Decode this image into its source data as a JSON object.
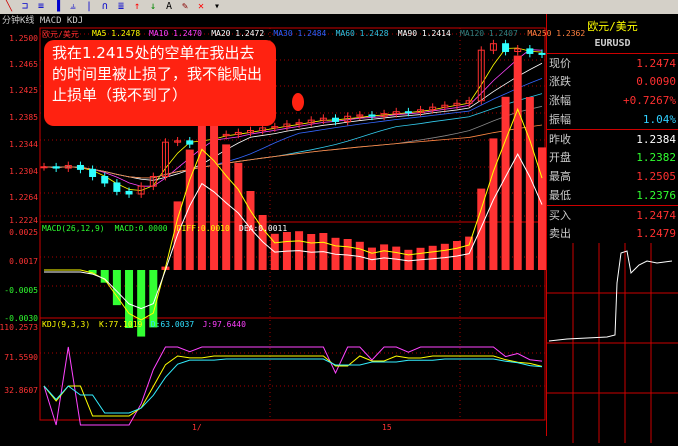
{
  "toolbar": {
    "icons": [
      "line-tool-icon",
      "channel-tool-icon",
      "parallel-lines-icon",
      "bars-icon",
      "fibonacci-icon",
      "vertical-line-icon",
      "gann-icon",
      "fan-icon",
      "up-arrow-icon",
      "down-arrow-icon",
      "text-icon",
      "eraser-icon",
      "delete-icon",
      "dropdown-icon"
    ],
    "glyphs": [
      "╲",
      "⊐",
      "≡",
      "▐",
      "⫨",
      "|",
      "∩",
      "≣",
      "↑",
      "↓",
      "A",
      "✎",
      "✕",
      "▾"
    ]
  },
  "tabs": {
    "label": "分钟K线 MACD KDJ"
  },
  "main": {
    "header": [
      {
        "t": "欧元/美元",
        "c": "#ff3030"
      },
      {
        "t": "MA5 1.2478",
        "c": "#ffff00"
      },
      {
        "t": "MA10 1.2470",
        "c": "#ff40ff"
      },
      {
        "t": "MA20 1.2472",
        "c": "#ffffff"
      },
      {
        "t": "MA30 1.2484",
        "c": "#3060ff"
      },
      {
        "t": "MA60 1.2428",
        "c": "#30c0e0"
      },
      {
        "t": "MA90 1.2414",
        "c": "#ffffff"
      },
      {
        "t": "MA120 1.2407",
        "c": "#308080"
      },
      {
        "t": "MA250 1.2362",
        "c": "#ff8040"
      }
    ],
    "y_labels": [
      "1.2500",
      "1.2465",
      "1.2425",
      "1.2385",
      "1.2344",
      "1.2304",
      "1.2264",
      "1.2224"
    ]
  },
  "macd": {
    "header": [
      {
        "t": "MACD(26,12,9)",
        "c": "#30ff30"
      },
      {
        "t": "MACD:0.0000",
        "c": "#30ff30"
      },
      {
        "t": "DIFF:0.0010",
        "c": "#ffff00"
      },
      {
        "t": "DEA:0.0011",
        "c": "#ffffff"
      }
    ],
    "y_labels": [
      "0.0025",
      "0.0017",
      "-0.0005",
      "-0.0030"
    ]
  },
  "kdj": {
    "header": [
      {
        "t": "KDJ(9,3,3)",
        "c": "#ffff00"
      },
      {
        "t": "K:77.1019",
        "c": "#ffff00"
      },
      {
        "t": "D:63.0037",
        "c": "#30e0ff"
      },
      {
        "t": "J:97.6440",
        "c": "#ff40ff"
      }
    ],
    "y_labels": [
      "110.2573",
      "71.5590",
      "32.8607"
    ]
  },
  "time_labels": [
    "1/",
    "15"
  ],
  "annotation": "我在1.2415处的空单在我出去的时间里被止损了，我不能贴出止损单（我不到了）",
  "quote": {
    "title": "欧元/美元",
    "symbol": "EURUSD",
    "rows": [
      {
        "l": "现价",
        "v": "1.2474",
        "c": "#ff3030"
      },
      {
        "l": "涨跌",
        "v": "0.0090",
        "c": "#ff3030"
      },
      {
        "l": "涨幅",
        "v": "+0.7267%",
        "c": "#ff3030"
      },
      {
        "l": "振幅",
        "v": "1.04%",
        "c": "#30d0ff"
      },
      {
        "l": "昨收",
        "v": "1.2384",
        "c": "#ffffff"
      },
      {
        "l": "开盘",
        "v": "1.2382",
        "c": "#30ff30"
      },
      {
        "l": "最高",
        "v": "1.2505",
        "c": "#ff3030"
      },
      {
        "l": "最低",
        "v": "1.2376",
        "c": "#30ff30"
      },
      {
        "l": "买入",
        "v": "1.2474",
        "c": "#ff3030"
      },
      {
        "l": "卖出",
        "v": "1.2479",
        "c": "#ff3030"
      }
    ]
  },
  "colors": {
    "up": "#ff3030",
    "down": "#30ffff",
    "frame": "#cc0000"
  },
  "chart_data": {
    "type": "candlestick",
    "ylim": [
      1.2224,
      1.2505
    ],
    "closes": [
      1.23,
      1.2298,
      1.2302,
      1.2296,
      1.2285,
      1.2275,
      1.2262,
      1.2258,
      1.227,
      1.2285,
      1.2338,
      1.234,
      1.2335,
      1.2345,
      1.2348,
      1.235,
      1.2353,
      1.2356,
      1.236,
      1.2362,
      1.2366,
      1.2368,
      1.2372,
      1.2375,
      1.237,
      1.2378,
      1.238,
      1.2378,
      1.2382,
      1.2385,
      1.2384,
      1.2388,
      1.2392,
      1.2395,
      1.2398,
      1.2402,
      1.248,
      1.249,
      1.2478,
      1.2482,
      1.2475,
      1.2474
    ]
  }
}
